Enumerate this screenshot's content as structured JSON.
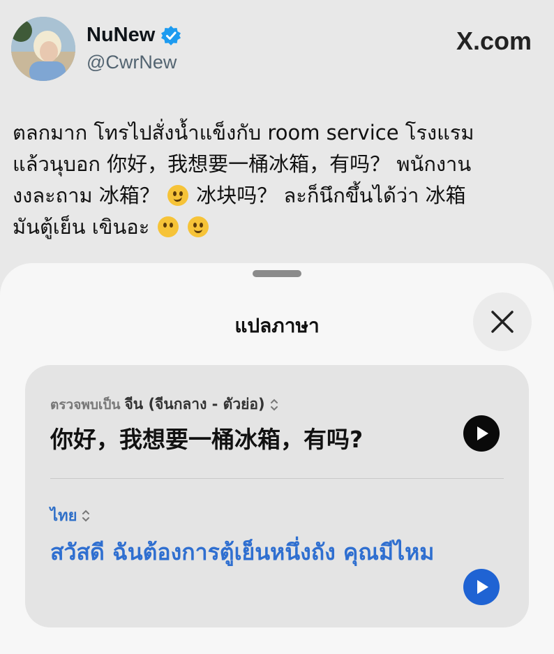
{
  "tweet": {
    "display_name": "NuNew",
    "handle": "@CwrNew",
    "site_logo": "X.com",
    "verified_icon": "verified-badge-icon",
    "text_lines": [
      "ตลกมาก โทรไปสั่งน้ำแข็งกับ room service โรงแรม",
      "แล้วนุบอก 你好，我想要一桶冰箱，有吗？ พนักงาน",
      "งงละถาม 冰箱？",
      "冰块吗？ ละก็นึกขึ้นได้ว่า 冰箱",
      "มันตู้เย็น เขินอะ"
    ]
  },
  "translate_sheet": {
    "title": "แปลภาษา",
    "close_icon": "close-icon",
    "source": {
      "detected_label": "ตรวจพบเป็น",
      "language": "จีน (จีนกลาง - ตัวย่อ)",
      "text": "你好，我想要一桶冰箱，有吗?"
    },
    "target": {
      "language": "ไทย",
      "text": "สวัสดี ฉันต้องการตู้เย็นหนึ่งถัง คุณมีไหม"
    },
    "colors": {
      "accent_blue": "#2f6fd0",
      "play_blue": "#1f63d3"
    }
  }
}
